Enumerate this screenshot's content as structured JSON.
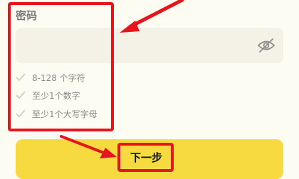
{
  "password": {
    "label": "密码",
    "value": "",
    "placeholder": "",
    "visibility_icon": "eye-off-icon",
    "rules": [
      {
        "text": "8-128 个字符",
        "icon": "check-icon"
      },
      {
        "text": "至少1个数字",
        "icon": "check-icon"
      },
      {
        "text": "至少1个大写字母",
        "icon": "check-icon"
      }
    ]
  },
  "next_button": {
    "label": "下一步",
    "color": "#f7da40"
  },
  "annotations": {
    "highlight_color": "#e8141c"
  }
}
